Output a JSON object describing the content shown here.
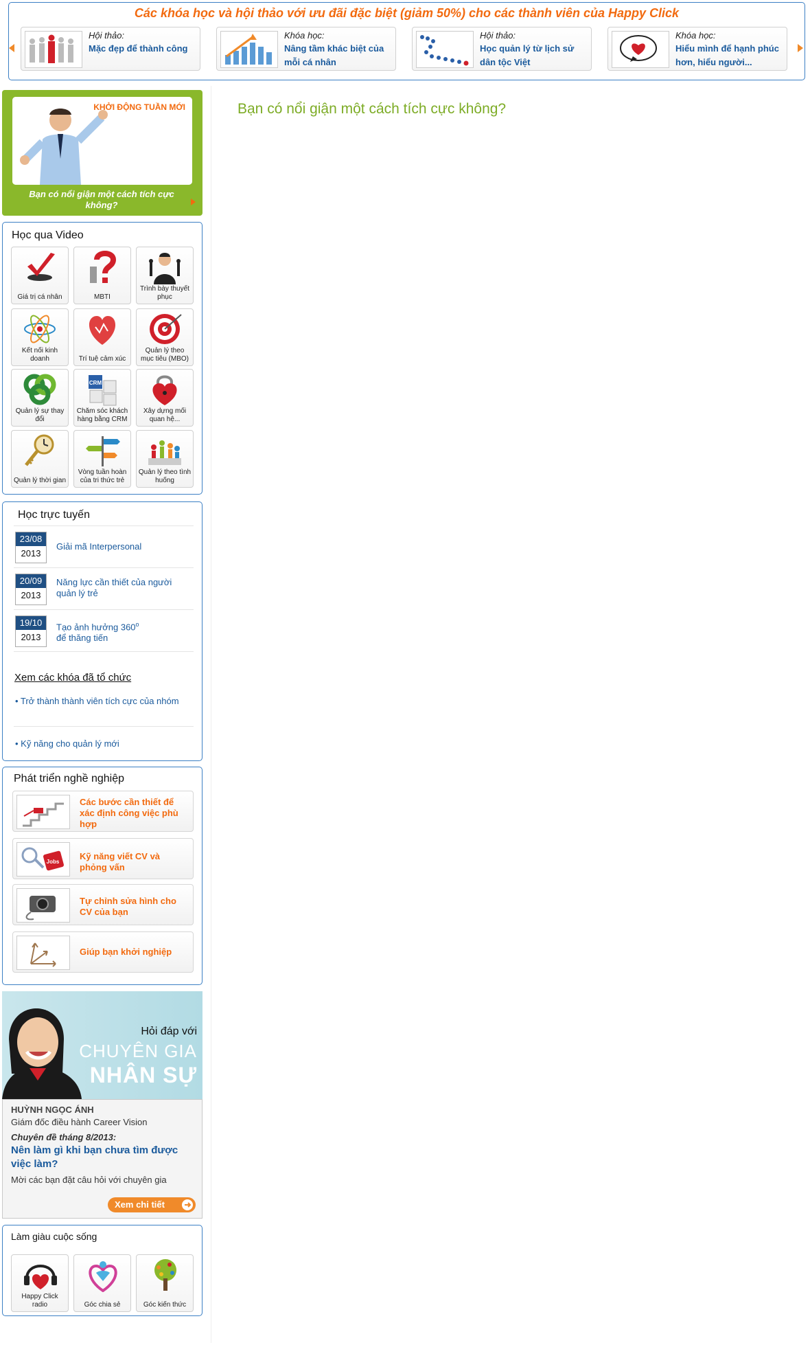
{
  "promo": {
    "title": "Các khóa học và hội thảo với ưu đãi đặc biệt (giảm 50%) cho các thành viên của Happy Click",
    "items": [
      {
        "kind": "Hội thảo:",
        "name": "Mặc đẹp để thành công"
      },
      {
        "kind": "Khóa học:",
        "name": "Nâng tầm khác biệt của mỗi cá nhân"
      },
      {
        "kind": "Hội thảo:",
        "name": "Học quản lý từ lịch sử dân tộc Việt"
      },
      {
        "kind": "Khóa học:",
        "name": "Hiểu mình để hạnh phúc hơn, hiểu người..."
      }
    ]
  },
  "weekly": {
    "tag": "KHỞI ĐỘNG TUẦN MỚI",
    "text": "Bạn có nổi giận một cách tích cực không?"
  },
  "video": {
    "title": "Học qua Video",
    "items": [
      {
        "label": "Giá trị cá nhân",
        "icon": "check-mark-icon"
      },
      {
        "label": "MBTI",
        "icon": "question-mark-icon"
      },
      {
        "label": "Trình bày thuyết phục",
        "icon": "speaker-icon"
      },
      {
        "label": "Kết nối kinh doanh",
        "icon": "atom-icon"
      },
      {
        "label": "Trí tuệ cảm xúc",
        "icon": "heart-icon"
      },
      {
        "label": "Quản lý theo mục tiêu (MBO)",
        "icon": "target-icon"
      },
      {
        "label": "Quản lý sự thay đổi",
        "icon": "recycle-icon"
      },
      {
        "label": "Chăm sóc khách hàng bằng CRM",
        "icon": "crm-blocks-icon"
      },
      {
        "label": "Xây dựng mối quan hệ...",
        "icon": "padlock-heart-icon"
      },
      {
        "label": "Quản lý thời gian",
        "icon": "clock-key-icon"
      },
      {
        "label": "Vòng tuần hoàn của tri thức trẻ",
        "icon": "signpost-icon"
      },
      {
        "label": "Quản lý theo tình huống",
        "icon": "people-blocks-icon"
      }
    ]
  },
  "online": {
    "title": "Học trực tuyến",
    "courses": [
      {
        "date": "23/08",
        "year": "2013",
        "title": "Giải mã Interpersonal"
      },
      {
        "date": "20/09",
        "year": "2013",
        "title": "Năng lực cần thiết của người quản lý trẻ"
      },
      {
        "date": "19/10",
        "year": "2013",
        "title": "Tạo ảnh hưởng 360",
        "sup": "o",
        "title2": "để thăng tiến"
      }
    ],
    "past_title": "Xem các khóa đã tổ chức",
    "past": [
      "• Trở thành thành viên tích cực của nhóm",
      "• Kỹ năng cho quản lý mới"
    ]
  },
  "career": {
    "title": "Phát triển nghề nghiệp",
    "items": [
      "Các bước cần thiết để xác định công việc phù hợp",
      "Kỹ năng viết CV và phỏng vấn",
      "Tự chỉnh sửa hình cho CV của bạn",
      "Giúp bạn khởi nghiệp"
    ]
  },
  "expert": {
    "heading": "Hỏi đáp với",
    "heading2": "CHUYÊN GIA",
    "heading3": "NHÂN SỰ",
    "name": "HUỲNH NGỌC ÁNH",
    "role": "Giám đốc điều hành Career Vision",
    "topic_label": "Chuyên đề tháng 8/2013:",
    "topic": "Nên làm gì khi bạn chưa tìm được việc làm?",
    "invite": "Mời các bạn đặt câu hỏi với chuyên gia",
    "button": "Xem chi tiết"
  },
  "life": {
    "title": "Làm giàu cuộc sống",
    "items": [
      {
        "label": "Happy Click radio",
        "icon": "headphones-heart-icon"
      },
      {
        "label": "Góc chia sẻ",
        "icon": "sharing-heart-icon"
      },
      {
        "label": "Góc kiến thức",
        "icon": "tree-icon"
      }
    ]
  },
  "main": {
    "title": "Bạn có nổi giận một cách tích cực không?"
  },
  "colors": {
    "accent_orange": "#f26a0f",
    "link_blue": "#1a5a9c",
    "border_blue": "#3b7fc4",
    "green": "#8ab82b",
    "title_green": "#7dac26"
  }
}
